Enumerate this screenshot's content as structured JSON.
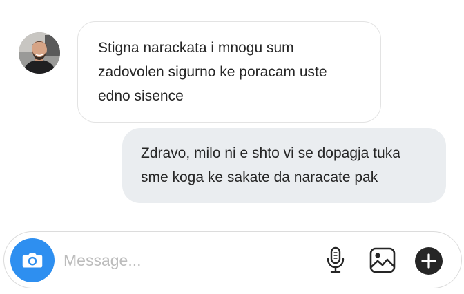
{
  "conversation": {
    "contact": {
      "avatar_icon": "contact-avatar"
    },
    "messages": [
      {
        "direction": "incoming",
        "text": "Stigna narackata i mnogu sum\nzadovolen sigurno ke poracam uste\nedno sisence"
      },
      {
        "direction": "outgoing",
        "text": "Zdravo, milo ni e shto vi se dopagja tuka\nsme koga ke sakate da naracate pak"
      }
    ]
  },
  "composer": {
    "placeholder": "Message...",
    "value": "",
    "camera_icon": "camera-icon",
    "mic_icon": "microphone-icon",
    "image_icon": "image-icon",
    "plus_icon": "plus-circle-icon"
  },
  "colors": {
    "accent": "#2e8ff0",
    "incoming_bubble": "#ffffff",
    "outgoing_bubble": "#eaedf0",
    "text": "#262626",
    "placeholder": "#bcbcbc"
  }
}
